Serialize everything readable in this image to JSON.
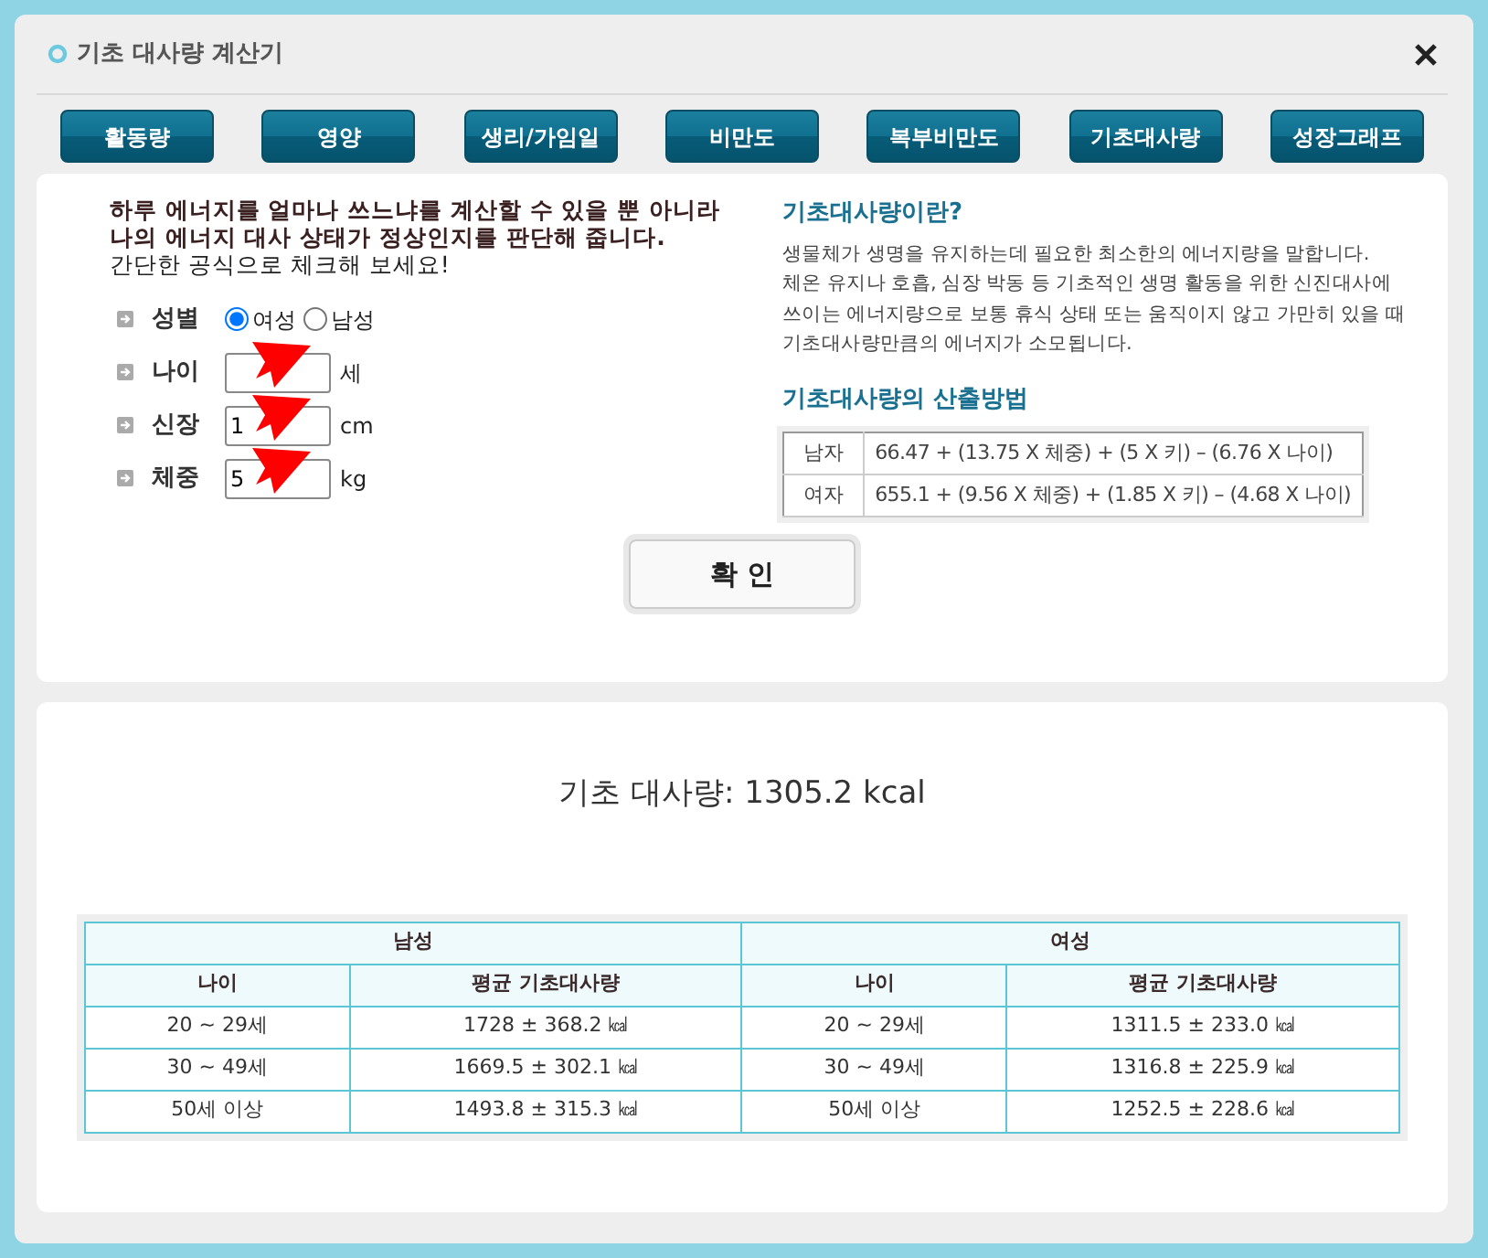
{
  "window": {
    "title": "기초 대사량 계산기"
  },
  "tabs": [
    {
      "label": "활동량"
    },
    {
      "label": "영양"
    },
    {
      "label": "생리/가임일"
    },
    {
      "label": "비만도"
    },
    {
      "label": "복부비만도"
    },
    {
      "label": "기초대사량"
    },
    {
      "label": "성장그래프"
    }
  ],
  "form": {
    "intro": [
      {
        "kind": "bold",
        "text": "하루 에너지를 얼마나 쓰느냐를 계산할 수 있을 뿐 아니라"
      },
      {
        "kind": "bold",
        "text": "나의 에너지 대사 상태가 정상인지를 판단해 줍니다."
      },
      {
        "kind": "normal",
        "text": "간단한 공식으로 체크해 보세요!"
      }
    ],
    "fields": [
      {
        "kind": "radio",
        "label": "성별",
        "options": [
          {
            "label": "여성",
            "selected": true
          },
          {
            "label": "남성",
            "selected": false
          }
        ]
      },
      {
        "kind": "text",
        "label": "나이",
        "unit": "세"
      },
      {
        "kind": "text",
        "label": "신장",
        "value": "1",
        "unit": "cm"
      },
      {
        "kind": "text",
        "label": "체중",
        "value": "5",
        "unit": "kg"
      }
    ],
    "submit": "확 인"
  },
  "info": {
    "heading": "기초대사량이란?",
    "paragraph": [
      "생물체가 생명을 유지하는데 필요한 최소한의 에너지량을 말합니다.",
      "체온 유지나 호흡, 심장 박동 등 기초적인 생명 활동을 위한 신진대사에",
      "쓰이는 에너지량으로 보통 휴식 상태 또는 움직이지 않고 가만히 있을 때",
      "기초대사량만큼의 에너지가 소모됩니다."
    ],
    "formula_heading": "기초대사량의 산출방법",
    "formulas": [
      {
        "label": "남자",
        "formula": "66.47 + (13.75 X 체중) + (5 X 키) – (6.76 X 나이)"
      },
      {
        "label": "여자",
        "formula": "655.1 + (9.56 X 체중) + (1.85 X 키) – (4.68 X 나이)"
      }
    ]
  },
  "result": {
    "text": "기초 대사량: 1305.2 kcal"
  },
  "table": {
    "groups": [
      "남성",
      "여성"
    ],
    "columns": [
      "나이",
      "평균 기초대사량",
      "나이",
      "평균 기초대사량"
    ],
    "rows": [
      [
        "20 ~ 29세",
        "1728 ± 368.2 ㎉",
        "20 ~ 29세",
        "1311.5 ± 233.0 ㎉"
      ],
      [
        "30 ~ 49세",
        "1669.5 ± 302.1 ㎉",
        "30 ~ 49세",
        "1316.8 ± 225.9 ㎉"
      ],
      [
        "50세 이상",
        "1493.8 ± 315.3 ㎉",
        "50세 이상",
        "1252.5 ± 228.6 ㎉"
      ]
    ]
  }
}
